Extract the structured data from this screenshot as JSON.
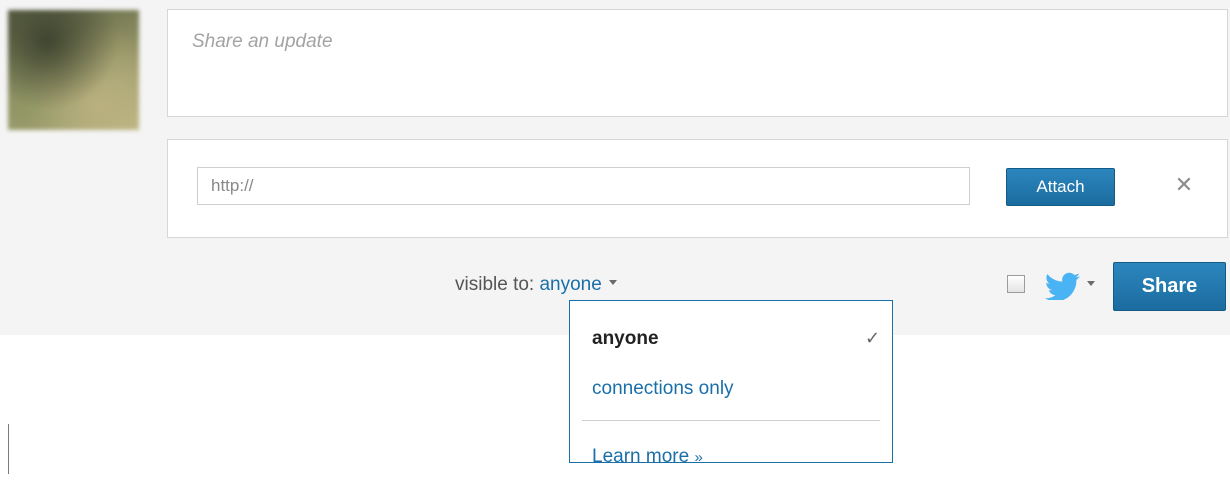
{
  "composer": {
    "update_placeholder": "Share an update",
    "url_value": "http://",
    "attach_label": "Attach",
    "close_symbol": "✕",
    "share_label": "Share"
  },
  "visibility": {
    "label": "visible to:",
    "selected": "anyone"
  },
  "dropdown": {
    "options": [
      {
        "label": "anyone",
        "selected": true
      },
      {
        "label": "connections only",
        "selected": false
      }
    ],
    "check_symbol": "✓",
    "learn_more": "Learn more",
    "learn_more_arrow": "»"
  },
  "twitter": {
    "checked": false,
    "icon": "twitter-bird-icon"
  },
  "colors": {
    "accent": "#1a6fa8",
    "button": "#2279b0",
    "twitter": "#4ab3f4"
  }
}
